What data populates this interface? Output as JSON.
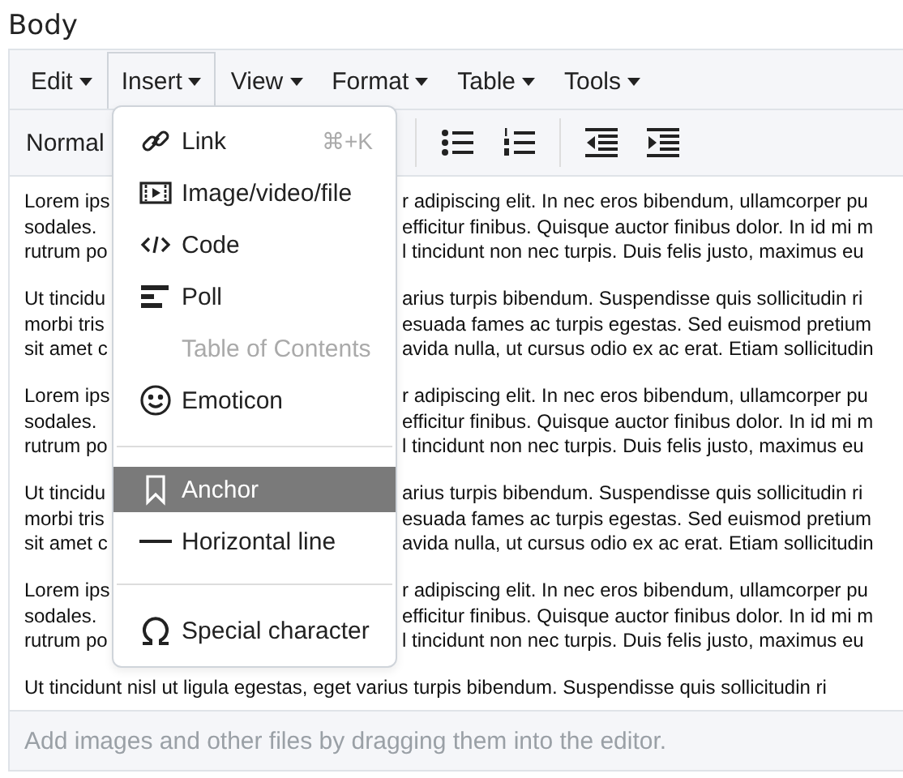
{
  "label": "Body",
  "menubar": [
    {
      "label": "Edit",
      "selected": false
    },
    {
      "label": "Insert",
      "selected": true
    },
    {
      "label": "View",
      "selected": false
    },
    {
      "label": "Format",
      "selected": false
    },
    {
      "label": "Table",
      "selected": false
    },
    {
      "label": "Tools",
      "selected": false
    }
  ],
  "toolbar": {
    "block_format": "Normal"
  },
  "paragraphs": [
    {
      "lines": [
        {
          "left": "Lorem ips",
          "right": "r adipiscing elit. In nec eros bibendum, ullamcorper pu"
        },
        {
          "left": "sodales.",
          "right": "efficitur finibus. Quisque auctor finibus dolor. In id mi m"
        },
        {
          "left": "rutrum po",
          "right": "l tincidunt non nec turpis. Duis felis justo, maximus eu"
        }
      ]
    },
    {
      "lines": [
        {
          "left": "Ut tincidu",
          "right": "arius turpis bibendum. Suspendisse quis sollicitudin ri"
        },
        {
          "left": "morbi tris",
          "right": "esuada fames ac turpis egestas. Sed euismod pretium"
        },
        {
          "left": "sit amet c",
          "right": "avida nulla, ut cursus odio ex ac erat. Etiam sollicitudin"
        }
      ]
    },
    {
      "lines": [
        {
          "left": "Lorem ips",
          "right": "r adipiscing elit. In nec eros bibendum, ullamcorper pu"
        },
        {
          "left": "sodales.",
          "right": "efficitur finibus. Quisque auctor finibus dolor. In id mi m"
        },
        {
          "left": "rutrum po",
          "right": "l tincidunt non nec turpis. Duis felis justo, maximus eu"
        }
      ]
    },
    {
      "lines": [
        {
          "left": "Ut tincidu",
          "right": "arius turpis bibendum. Suspendisse quis sollicitudin ri"
        },
        {
          "left": "morbi tris",
          "right": "esuada fames ac turpis egestas. Sed euismod pretium"
        },
        {
          "left": "sit amet c",
          "right": "avida nulla, ut cursus odio ex ac erat. Etiam sollicitudin"
        }
      ]
    },
    {
      "lines": [
        {
          "left": "Lorem ips",
          "right": "r adipiscing elit. In nec eros bibendum, ullamcorper pu"
        },
        {
          "left": "sodales.",
          "right": "efficitur finibus. Quisque auctor finibus dolor. In id mi m"
        },
        {
          "left": "rutrum po",
          "right": "l tincidunt non nec turpis. Duis felis justo, maximus eu"
        }
      ]
    },
    {
      "lines": [
        {
          "full": "Ut tincidunt nisl ut ligula egestas, eget varius turpis bibendum. Suspendisse quis sollicitudin ri"
        }
      ]
    }
  ],
  "insert_menu": [
    {
      "kind": "item",
      "label": "Link",
      "shortcut": "⌘+K",
      "disabled": false,
      "selected": false
    },
    {
      "kind": "item",
      "label": "Image/video/file",
      "disabled": false,
      "selected": false
    },
    {
      "kind": "item",
      "label": "Code",
      "disabled": false,
      "selected": false
    },
    {
      "kind": "item",
      "label": "Poll",
      "disabled": false,
      "selected": false
    },
    {
      "kind": "item",
      "label": "Table of Contents",
      "disabled": true,
      "selected": false
    },
    {
      "kind": "item",
      "label": "Emoticon",
      "disabled": false,
      "selected": false
    },
    {
      "kind": "divider"
    },
    {
      "kind": "item",
      "label": "Anchor",
      "disabled": false,
      "selected": true
    },
    {
      "kind": "item",
      "label": "Horizontal line",
      "disabled": false,
      "selected": false
    },
    {
      "kind": "divider"
    },
    {
      "kind": "item",
      "label": "Special character",
      "disabled": false,
      "selected": false
    }
  ],
  "status_bar": "Add images and other files by dragging them into the editor."
}
